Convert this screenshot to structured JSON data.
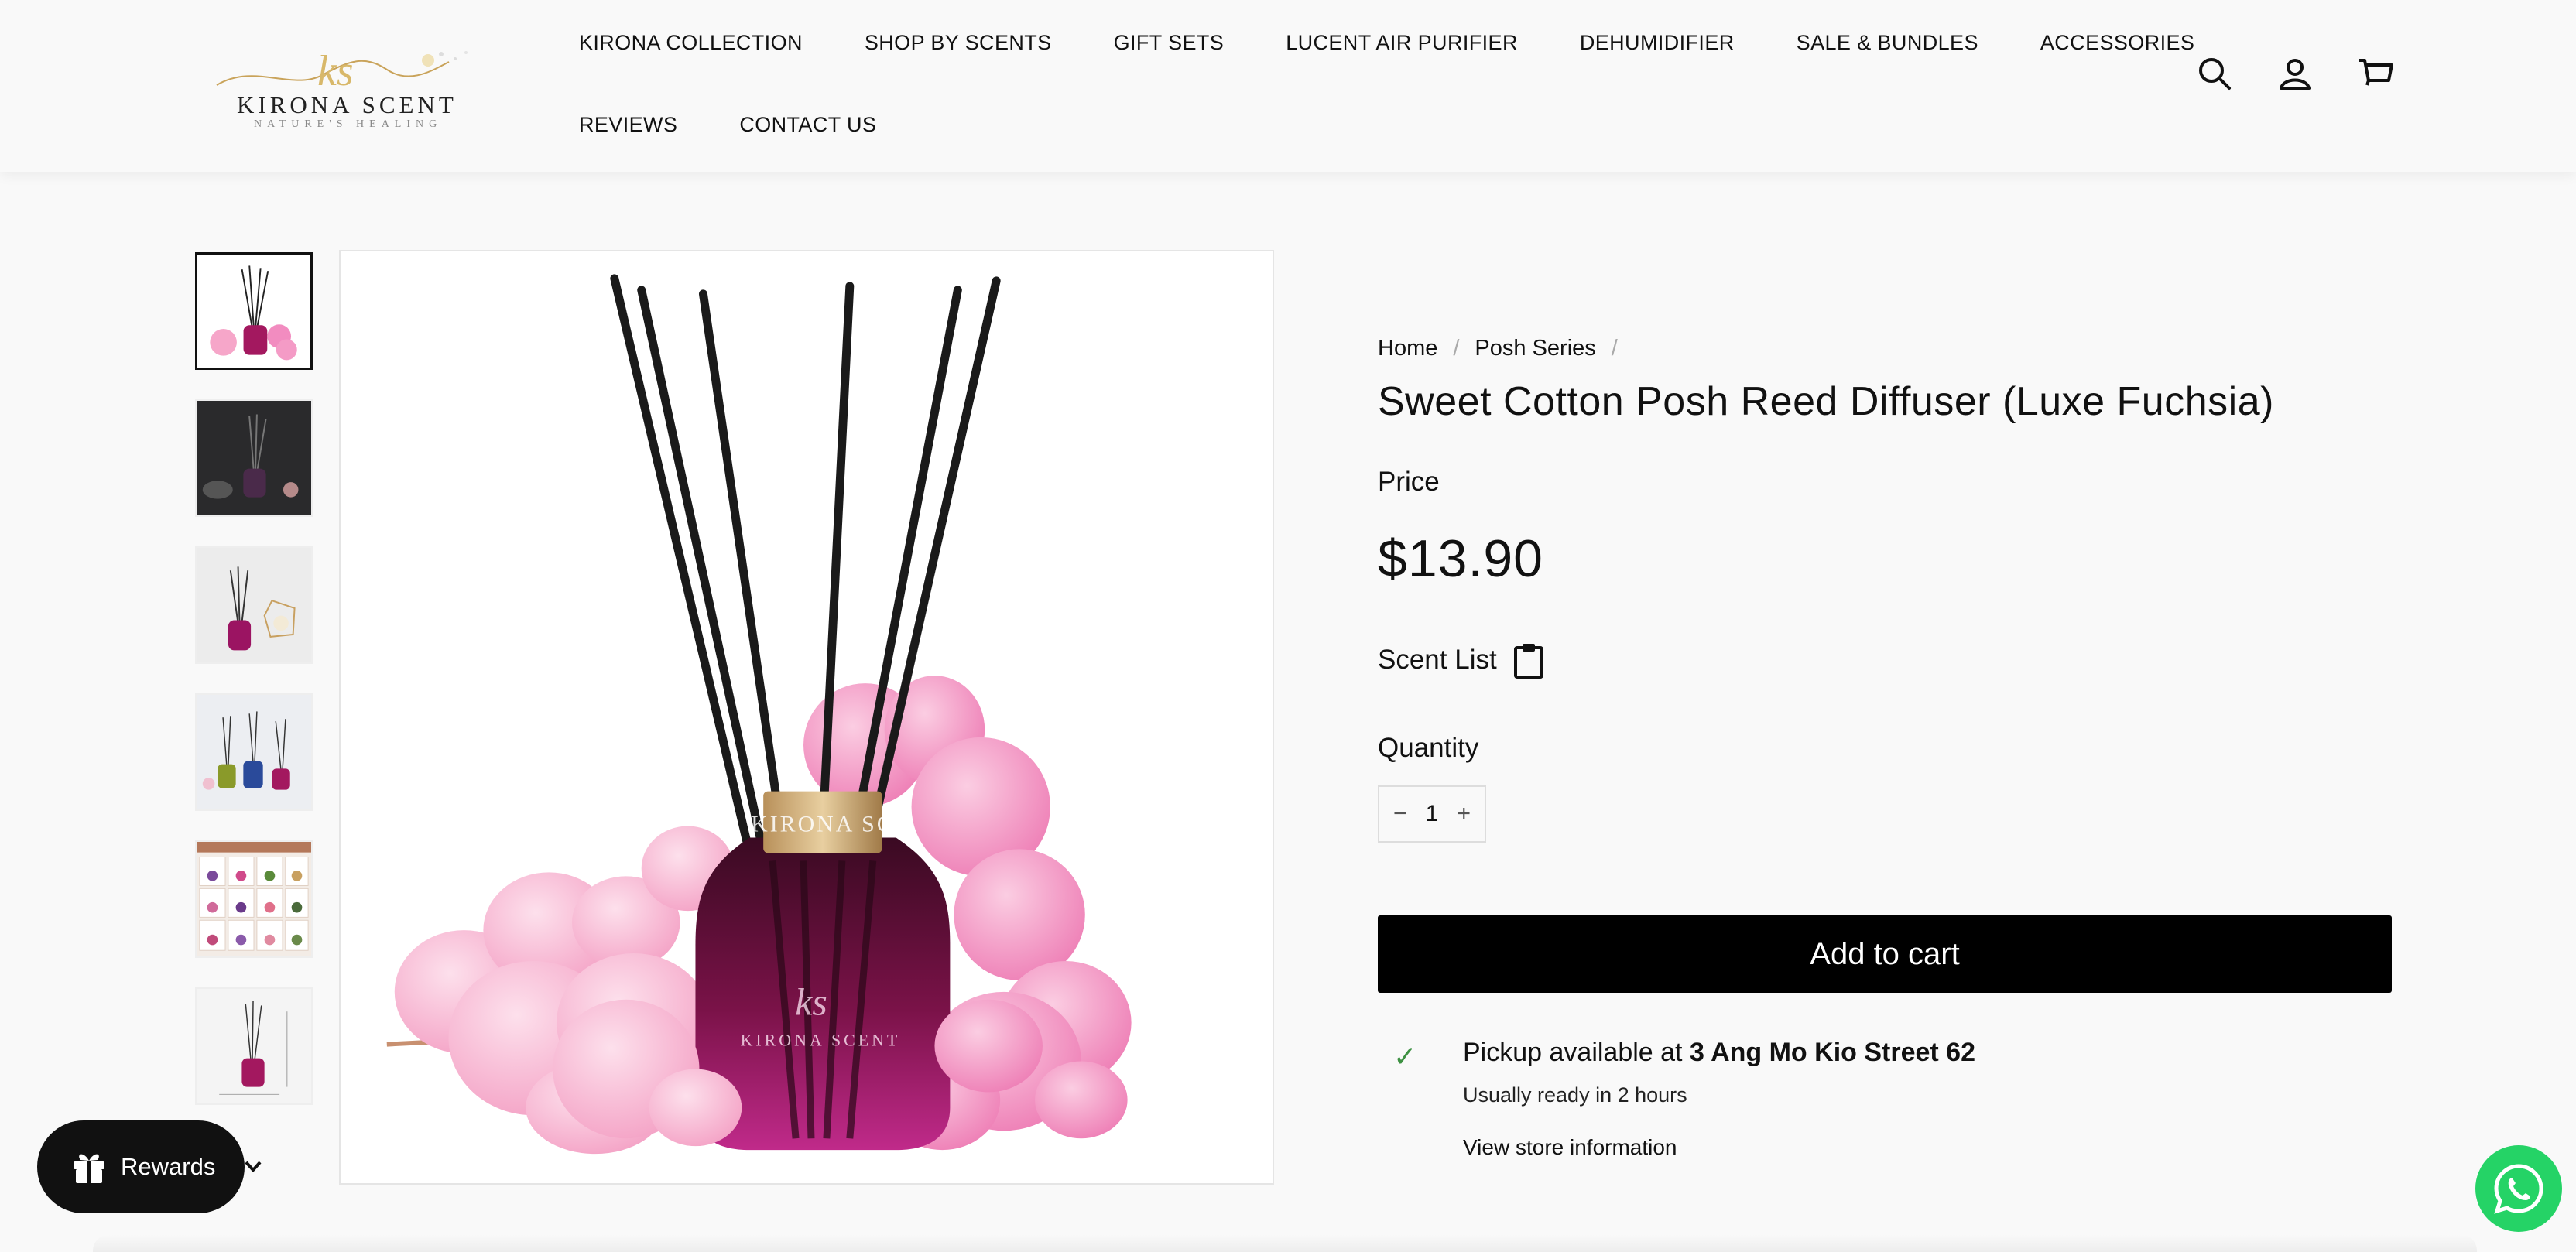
{
  "brand": {
    "name": "KIRONA SCENT",
    "tagline": "NATURE'S HEALING",
    "monogram": "ks"
  },
  "nav": {
    "row1": [
      "KIRONA COLLECTION",
      "SHOP BY SCENTS",
      "GIFT SETS",
      "LUCENT AIR PURIFIER",
      "DEHUMIDIFIER",
      "SALE & BUNDLES",
      "ACCESSORIES"
    ],
    "row2": [
      "REVIEWS",
      "CONTACT US"
    ]
  },
  "header_icons": [
    "search-icon",
    "account-icon",
    "cart-icon"
  ],
  "breadcrumb": {
    "home": "Home",
    "category": "Posh Series",
    "separator": "/"
  },
  "product": {
    "title": "Sweet Cotton Posh Reed Diffuser (Luxe Fuchsia)",
    "price_label": "Price",
    "price": "$13.90",
    "scent_list_label": "Scent List",
    "quantity_label": "Quantity",
    "quantity": "1",
    "qty_minus": "−",
    "qty_plus": "+",
    "add_to_cart": "Add to cart",
    "bottle_label": "KIRONA SCENT"
  },
  "pickup": {
    "prefix": "Pickup available at",
    "location": "3 Ang Mo Kio Street 62",
    "ready": "Usually ready in 2 hours",
    "store_link": "View store information",
    "check": "✓"
  },
  "rewards": {
    "label": "Rewards"
  },
  "colors": {
    "accent": "#000000",
    "check": "#3d9142",
    "whatsapp": "#25d366",
    "bottle": "#b01a7a",
    "cotton": "#f28cc0"
  }
}
